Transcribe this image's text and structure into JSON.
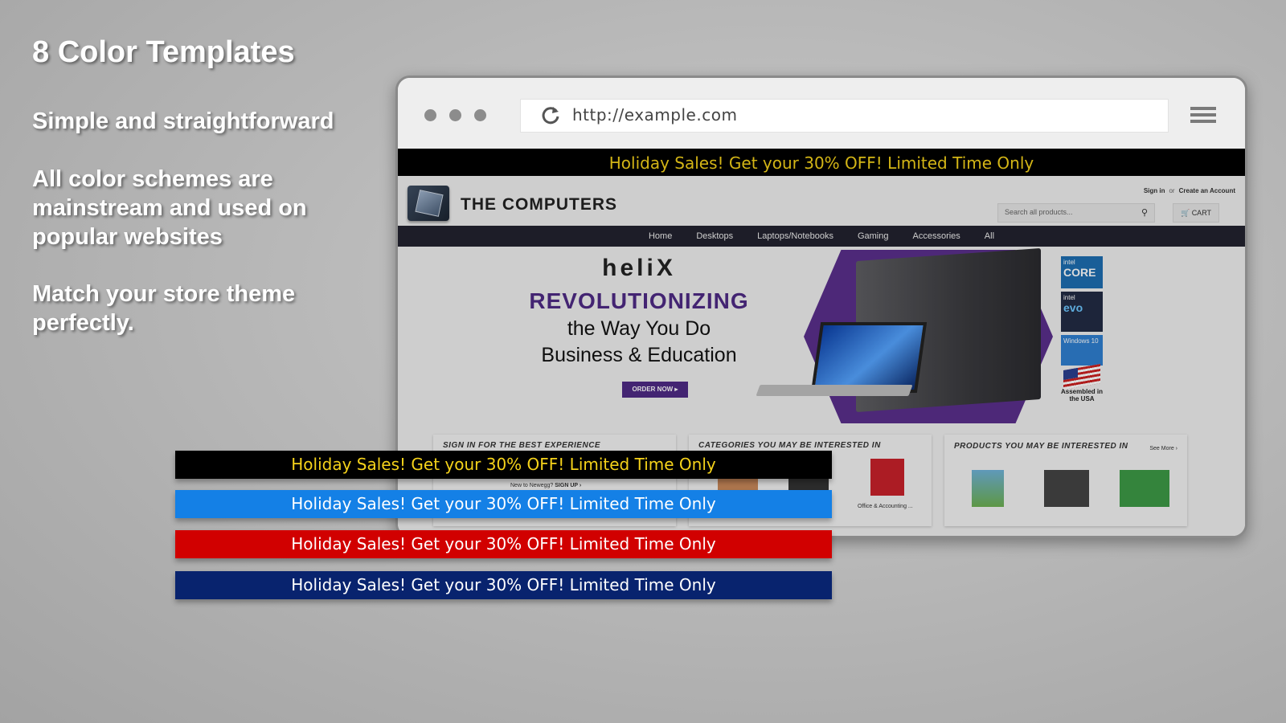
{
  "hero": {
    "title": "8 Color Templates",
    "line1": "Simple and straightforward",
    "line2": "All color schemes are mainstream and used on popular websites",
    "line3": "Match your store theme perfectly."
  },
  "browser": {
    "url": "http://example.com",
    "site": {
      "announcement": "Holiday Sales! Get your 30% OFF! Limited Time Only",
      "name": "THE COMPUTERS",
      "sign_in": "Sign in",
      "or": "or",
      "create_account": "Create an Account",
      "search_placeholder": "Search all products...",
      "cart": "CART",
      "nav": [
        "Home",
        "Desktops",
        "Laptops/Notebooks",
        "Gaming",
        "Accessories",
        "All"
      ],
      "banner": {
        "brand": "heli",
        "brand_mark": "X",
        "headline": "REVOLUTIONIZING",
        "sub1": "the Way You Do",
        "sub2": "Business & Education",
        "cta": "ORDER NOW ▸",
        "badges": [
          "intel",
          "CORE",
          "intel",
          "evo",
          "Windows 10"
        ],
        "assembled": "Assembled in the USA"
      },
      "panels": {
        "sign_in_title": "SIGN IN FOR THE BEST EXPERIENCE",
        "signup_prompt": "New to Newegg?",
        "signup_link": "SIGN UP ›",
        "categories_title": "CATEGORIES YOU MAY BE INTERESTED IN",
        "category_caption": "Office & Accounting ...",
        "products_title": "PRODUCTS YOU MAY BE INTERESTED IN",
        "see_more": "See More ›"
      }
    }
  },
  "templates": [
    {
      "text": "Holiday Sales! Get your 30% OFF! Limited Time Only",
      "bg": "#000000",
      "fg": "#f5d21a"
    },
    {
      "text": "Holiday Sales! Get your 30% OFF! Limited Time Only",
      "bg": "#1480e6",
      "fg": "#ffffff"
    },
    {
      "text": "Holiday Sales! Get your 30% OFF! Limited Time Only",
      "bg": "#d10000",
      "fg": "#ffffff"
    },
    {
      "text": "Holiday Sales! Get your 30% OFF! Limited Time Only",
      "bg": "#08236e",
      "fg": "#ffffff"
    }
  ]
}
